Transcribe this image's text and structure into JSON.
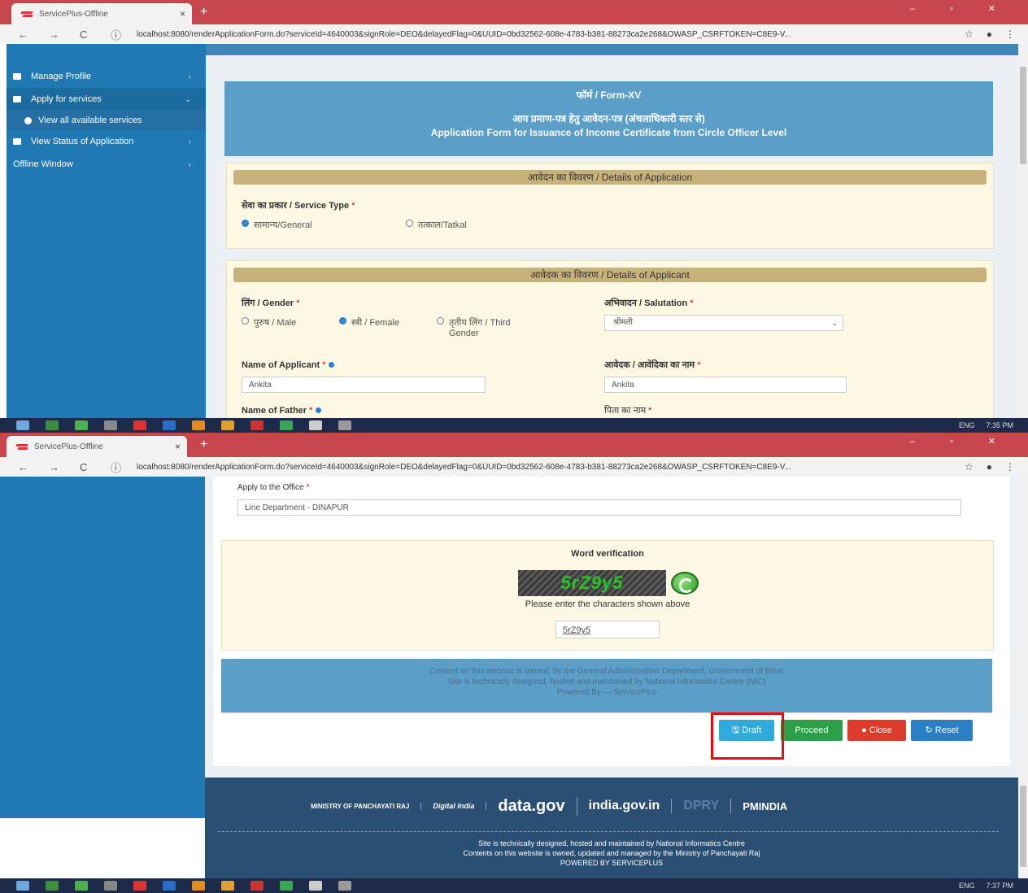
{
  "browser": {
    "tab_title": "ServicePlus-Offline",
    "tab_close": "×",
    "new_tab": "+",
    "window_controls": "–  ▫  ✕",
    "url": "localhost:8080/renderApplicationForm.do?serviceId=4640003&signRole=DEO&delayedFlag=0&UUID=0bd32562-608e-4783-b381-88273ca2e268&OWASP_CSRFTOKEN=C8E9-V...",
    "nav_back": "←",
    "nav_forward": "→",
    "nav_reload": "C",
    "info": "ⓘ",
    "star": "☆",
    "account": "●",
    "menu": "⋮"
  },
  "sidebar": {
    "items": [
      {
        "label": "Manage Profile",
        "arrow": "‹"
      },
      {
        "label": "Apply for services",
        "arrow": "⌄"
      },
      {
        "label": "View all available services"
      },
      {
        "label": "View Status of Application",
        "arrow": "‹"
      },
      {
        "label": "Offline Window",
        "arrow": "‹"
      }
    ]
  },
  "form": {
    "header_line1": "फॉर्म / Form-XV",
    "header_line2": "आय प्रमाण-पत्र हेतु आवेदन-पत्र (अंचलाधिकारी स्तर से)",
    "header_line3": "Application Form for Issuance of Income Certificate from Circle Officer Level",
    "application_section": "आवेदन का विवरण / Details of Application",
    "service_type_label": "सेवा का प्रकार / Service Type",
    "service_general": "सामान्य/General",
    "service_tatkal": "तत्काल/Tatkal",
    "applicant_section": "आवेदक का विवरण / Details of Applicant",
    "gender_label": "लिंग / Gender",
    "gender_male": "पुरुष / Male",
    "gender_female": "स्त्री / Female",
    "gender_third": "तृतीय लिंग / Third Gender",
    "salutation_label": "अभिवादन / Salutation",
    "salutation_value": "श्रीमती",
    "name_label": "Name of Applicant",
    "name_value": "Ankita",
    "name_hindi_label": "आवेदक / आवेदिका का नाम",
    "name_hindi_value": "Ankita",
    "father_label": "Name of Father",
    "father_hindi_label": "पिता का नाम",
    "required_mark": "*"
  },
  "page2": {
    "office_label": "Apply to the Office",
    "office_value": "Line Department - DINAPUR",
    "verification_title": "Word verification",
    "captcha_text": "5rZ9y5",
    "captcha_hint": "Please enter the characters shown above",
    "captcha_input": "5rZ9y5",
    "notice_line1": "Content on this website is owned, by the General Administration Department, Government of Bihar",
    "notice_line2": "Site is technically designed, hosted and maintained by National Informatics Centre (NIC)",
    "notice_line3": "Powered By — ServicePlus",
    "btn_draft": "Draft",
    "btn_proceed": "Proceed",
    "btn_close": "Close",
    "btn_reset": "Reset"
  },
  "footer": {
    "logo_panchayat": "MINISTRY OF PANCHAYATI RAJ",
    "logo_digital_india": "Digital India",
    "logo_datagov": "data.gov",
    "logo_indiagov": "india.gov.in",
    "logo_dpry": "DPRY",
    "logo_pmindia": "PMINDIA",
    "line1": "Site is technically designed, hosted and maintained by National Informatics Centre",
    "line2": "Contents on this website is owned, updated and managed by the Ministry of Panchayati Raj",
    "line3": "POWERED BY SERVICEPLUS"
  },
  "taskbar": {
    "lang": "ENG",
    "time1": "7:35 PM",
    "time2": "7:37 PM"
  },
  "colors": {
    "sidebar": "#2179b4",
    "tabbar": "#c8474f",
    "highlight": "#dd1111"
  }
}
